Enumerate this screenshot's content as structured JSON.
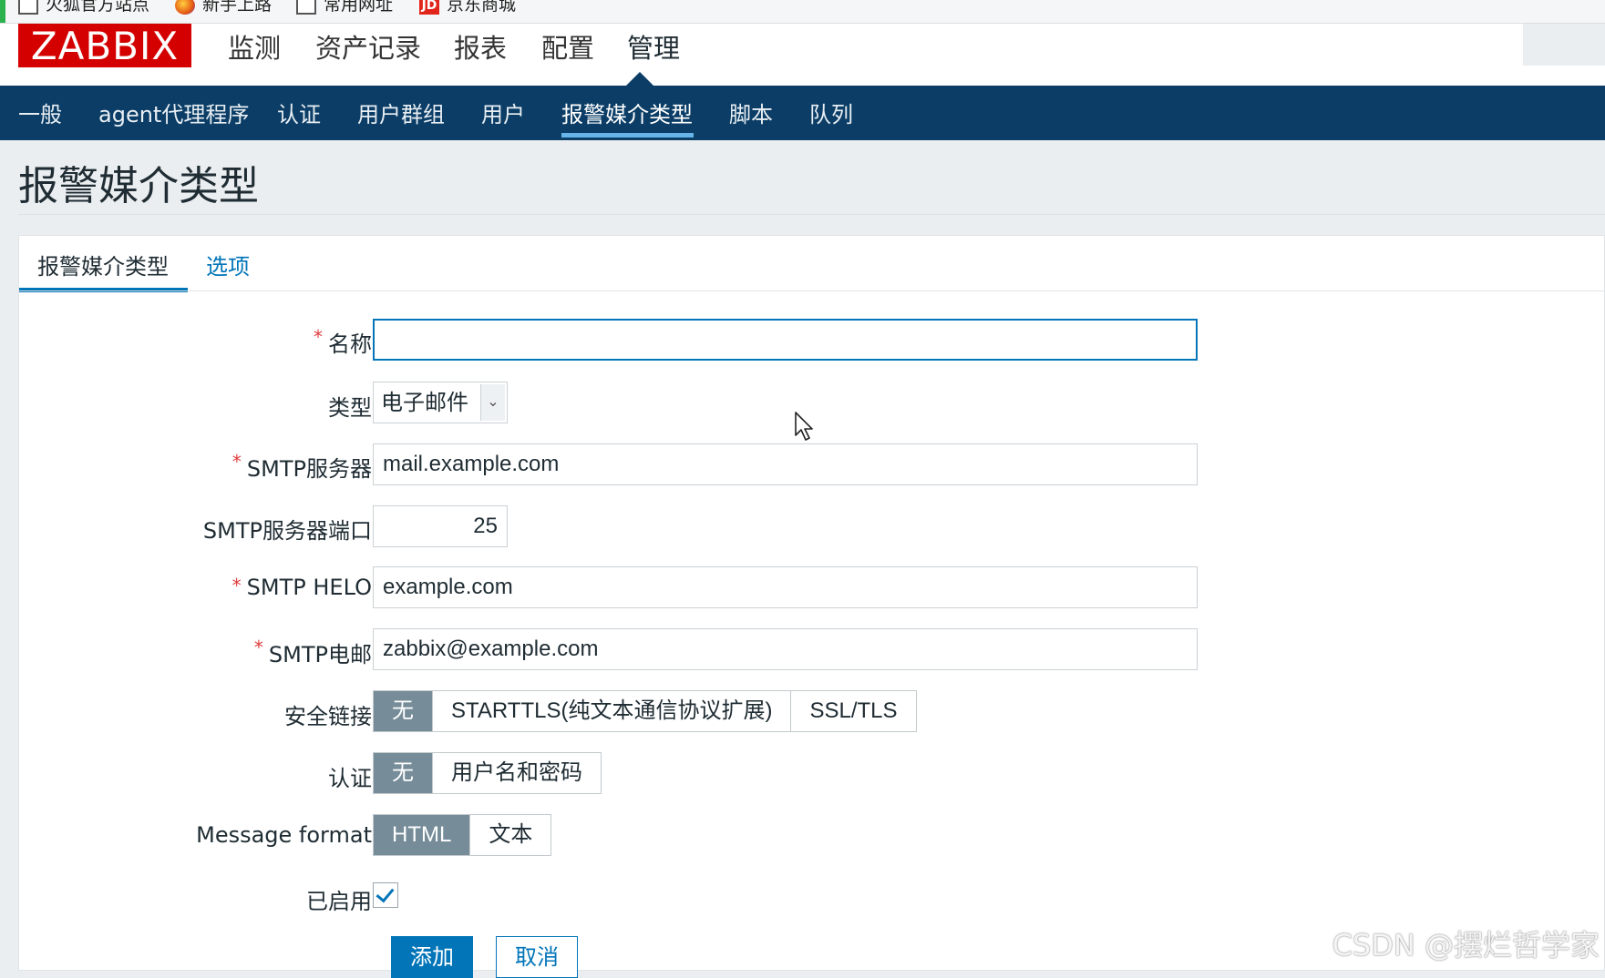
{
  "bookmarks": [
    {
      "label": "火狐官方站点",
      "icon": "page-icon"
    },
    {
      "label": "新手上路",
      "icon": "firefox-icon"
    },
    {
      "label": "常用网址",
      "icon": "page-icon"
    },
    {
      "label": "京东商城",
      "icon": "jd-icon",
      "icon_text": "JD"
    }
  ],
  "logo": "ZABBIX",
  "top_nav": [
    "监测",
    "资产记录",
    "报表",
    "配置",
    "管理"
  ],
  "top_nav_active": "管理",
  "sub_nav": [
    "一般",
    "agent代理程序",
    "认证",
    "用户群组",
    "用户",
    "报警媒介类型",
    "脚本",
    "队列"
  ],
  "sub_nav_active": "报警媒介类型",
  "page_title": "报警媒介类型",
  "tabs": {
    "active": "报警媒介类型",
    "other": "选项"
  },
  "form": {
    "name": {
      "label": "名称",
      "required": "*",
      "value": ""
    },
    "type": {
      "label": "类型",
      "value": "电子邮件"
    },
    "smtp_server": {
      "label": "SMTP服务器",
      "required": "*",
      "value": "mail.example.com"
    },
    "smtp_port": {
      "label": "SMTP服务器端口",
      "value": "25"
    },
    "smtp_helo": {
      "label": "SMTP HELO",
      "required": "*",
      "value": "example.com"
    },
    "smtp_email": {
      "label": "SMTP电邮",
      "required": "*",
      "value": "zabbix@example.com"
    },
    "connection_security": {
      "label": "安全链接",
      "options": [
        "无",
        "STARTTLS(纯文本通信协议扩展)",
        "SSL/TLS"
      ],
      "selected": "无"
    },
    "authentication": {
      "label": "认证",
      "options": [
        "无",
        "用户名和密码"
      ],
      "selected": "无"
    },
    "message_format": {
      "label": "Message format",
      "options": [
        "HTML",
        "文本"
      ],
      "selected": "HTML"
    },
    "enabled": {
      "label": "已启用",
      "checked": true
    }
  },
  "buttons": {
    "add": "添加",
    "cancel": "取消"
  },
  "watermark": "CSDN @摆烂哲学家",
  "colors": {
    "brand": "#d40000",
    "nav_bg": "#0b3d66",
    "accent": "#0275b8",
    "segment_on": "#768d99",
    "required": "#e03c3c"
  }
}
